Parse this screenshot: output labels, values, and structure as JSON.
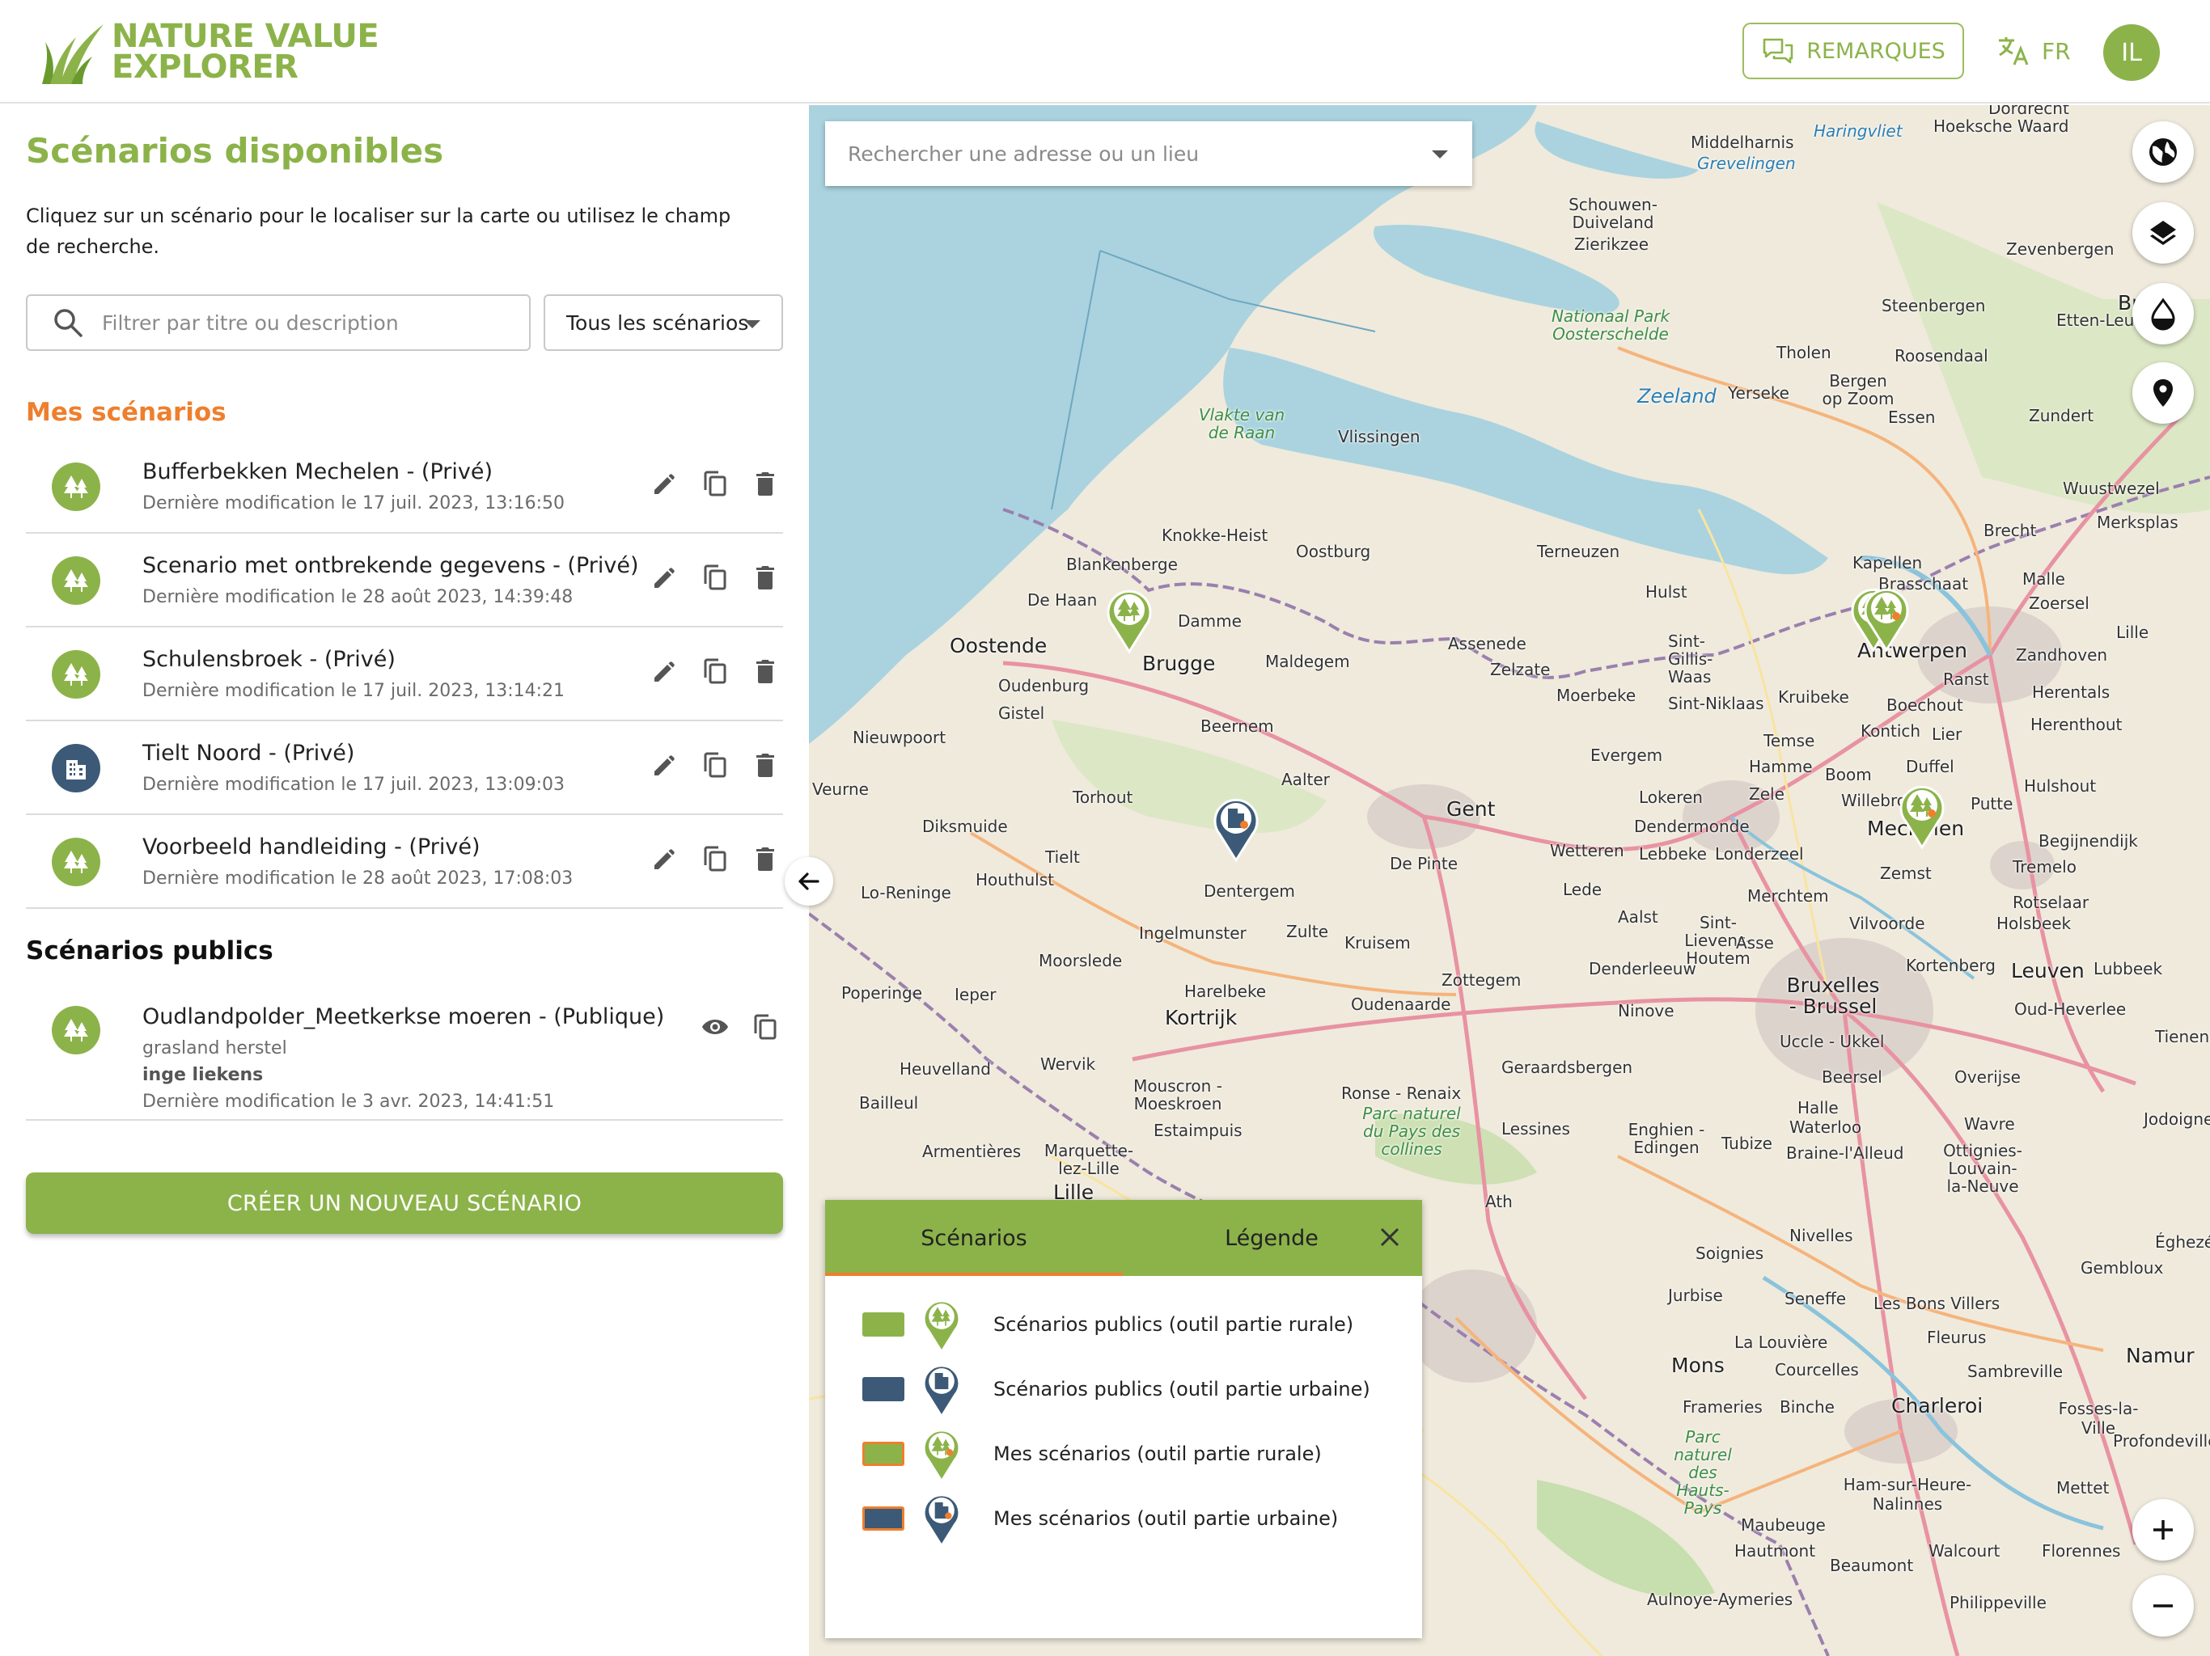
{
  "header": {
    "logo_line1": "NATURE VALUE",
    "logo_line2": "EXPLORER",
    "remarks_button": "REMARQUES",
    "language": "FR",
    "avatar_initials": "IL"
  },
  "sidebar": {
    "title": "Scénarios disponibles",
    "description": "Cliquez sur un scénario pour le localiser sur la carte ou utilisez le champ de recherche.",
    "filter_placeholder": "Filtrer par titre ou description",
    "scenario_filter_selected": "Tous les scénarios",
    "my_scenarios_heading": "Mes scénarios",
    "my_scenarios": [
      {
        "title": "Bufferbekken Mechelen - (Privé)",
        "modified": "Dernière modification le 17 juil. 2023, 13:16:50",
        "type": "rural"
      },
      {
        "title": "Scenario met ontbrekende gegevens - (Privé)",
        "modified": "Dernière modification le 28 août 2023, 14:39:48",
        "type": "rural"
      },
      {
        "title": "Schulensbroek - (Privé)",
        "modified": "Dernière modification le 17 juil. 2023, 13:14:21",
        "type": "rural"
      },
      {
        "title": "Tielt Noord - (Privé)",
        "modified": "Dernière modification le 17 juil. 2023, 13:09:03",
        "type": "urban"
      },
      {
        "title": "Voorbeeld handleiding - (Privé)",
        "modified": "Dernière modification le 28 août 2023, 17:08:03",
        "type": "rural"
      }
    ],
    "public_scenarios_heading": "Scénarios publics",
    "public_scenarios": [
      {
        "title": "Oudlandpolder_Meetkerkse moeren - (Publique)",
        "description": "grasland herstel",
        "author": "inge liekens",
        "modified": "Dernière modification le 3 avr. 2023, 14:41:51",
        "type": "rural"
      }
    ],
    "create_button": "CRÉER UN NOUVEAU SCÉNARIO"
  },
  "map": {
    "search_placeholder": "Rechercher une adresse ou un lieu",
    "places": [
      {
        "label": "Dordrecht",
        "style": "normal"
      },
      {
        "label": "Middelharnis",
        "style": "normal"
      },
      {
        "label": "Haringvliet",
        "style": "water"
      },
      {
        "label": "Hoeksche Waard",
        "style": "normal"
      },
      {
        "label": "Grevelingen",
        "style": "water"
      },
      {
        "label": "Schouwen-Duiveland",
        "style": "normal"
      },
      {
        "label": "Zierikzee",
        "style": "normal"
      },
      {
        "label": "Nationaal Park Oosterschelde",
        "style": "park"
      },
      {
        "label": "Zevenbergen",
        "style": "normal"
      },
      {
        "label": "Breda",
        "style": "big"
      },
      {
        "label": "Steenbergen",
        "style": "normal"
      },
      {
        "label": "Etten-Leur",
        "style": "normal"
      },
      {
        "label": "Tholen",
        "style": "normal"
      },
      {
        "label": "Roosendaal",
        "style": "normal"
      },
      {
        "label": "Bergen op Zoom",
        "style": "normal"
      },
      {
        "label": "Zeeland",
        "style": "water"
      },
      {
        "label": "Yerseke",
        "style": "normal"
      },
      {
        "label": "Vlakte van de Raan",
        "style": "park"
      },
      {
        "label": "Vlissingen",
        "style": "normal"
      },
      {
        "label": "Essen",
        "style": "normal"
      },
      {
        "label": "Zundert",
        "style": "normal"
      },
      {
        "label": "Wuustwezel",
        "style": "normal"
      },
      {
        "label": "Knokke-Heist",
        "style": "normal"
      },
      {
        "label": "Oostburg",
        "style": "normal"
      },
      {
        "label": "Terneuzen",
        "style": "normal"
      },
      {
        "label": "Blankenberge",
        "style": "normal"
      },
      {
        "label": "Kapellen",
        "style": "normal"
      },
      {
        "label": "Brecht",
        "style": "normal"
      },
      {
        "label": "Merksplas",
        "style": "normal"
      },
      {
        "label": "Brasschaat",
        "style": "normal"
      },
      {
        "label": "Malle",
        "style": "normal"
      },
      {
        "label": "De Haan",
        "style": "normal"
      },
      {
        "label": "Damme",
        "style": "normal"
      },
      {
        "label": "Hulst",
        "style": "normal"
      },
      {
        "label": "Zoersel",
        "style": "normal"
      },
      {
        "label": "Oostende",
        "style": "big"
      },
      {
        "label": "Brugge",
        "style": "big"
      },
      {
        "label": "Maldegem",
        "style": "normal"
      },
      {
        "label": "Assenede",
        "style": "normal"
      },
      {
        "label": "Sint-Gillis-Waas",
        "style": "normal"
      },
      {
        "label": "Antwerpen",
        "style": "big"
      },
      {
        "label": "Zandhoven",
        "style": "normal"
      },
      {
        "label": "Lille",
        "style": "normal"
      },
      {
        "label": "Oudenburg",
        "style": "normal"
      },
      {
        "label": "Zelzate",
        "style": "normal"
      },
      {
        "label": "Ranst",
        "style": "normal"
      },
      {
        "label": "Gistel",
        "style": "normal"
      },
      {
        "label": "Moerbeke",
        "style": "normal"
      },
      {
        "label": "Sint-Niklaas",
        "style": "normal"
      },
      {
        "label": "Kruibeke",
        "style": "normal"
      },
      {
        "label": "Boechout",
        "style": "normal"
      },
      {
        "label": "Herentals",
        "style": "normal"
      },
      {
        "label": "Beernem",
        "style": "normal"
      },
      {
        "label": "Kontich",
        "style": "normal"
      },
      {
        "label": "Lier",
        "style": "normal"
      },
      {
        "label": "Herenthout",
        "style": "normal"
      },
      {
        "label": "Nieuwpoort",
        "style": "normal"
      },
      {
        "label": "Temse",
        "style": "normal"
      },
      {
        "label": "Evergem",
        "style": "normal"
      },
      {
        "label": "Hamme",
        "style": "normal"
      },
      {
        "label": "Duffel",
        "style": "normal"
      },
      {
        "label": "Aalter",
        "style": "normal"
      },
      {
        "label": "Boom",
        "style": "normal"
      },
      {
        "label": "Hulshout",
        "style": "normal"
      },
      {
        "label": "Veurne",
        "style": "normal"
      },
      {
        "label": "Torhout",
        "style": "normal"
      },
      {
        "label": "Lokeren",
        "style": "normal"
      },
      {
        "label": "Zele",
        "style": "normal"
      },
      {
        "label": "Willebroek",
        "style": "normal"
      },
      {
        "label": "Putte",
        "style": "normal"
      },
      {
        "label": "Gent",
        "style": "big"
      },
      {
        "label": "Diksmuide",
        "style": "normal"
      },
      {
        "label": "Dendermonde",
        "style": "normal"
      },
      {
        "label": "Mechelen",
        "style": "big"
      },
      {
        "label": "Begijnendijk",
        "style": "normal"
      },
      {
        "label": "Wetteren",
        "style": "normal"
      },
      {
        "label": "Lebbeke",
        "style": "normal"
      },
      {
        "label": "Londerzeel",
        "style": "normal"
      },
      {
        "label": "Tielt",
        "style": "normal"
      },
      {
        "label": "De Pinte",
        "style": "normal"
      },
      {
        "label": "Tremelo",
        "style": "normal"
      },
      {
        "label": "Houthulst",
        "style": "normal"
      },
      {
        "label": "Dentergem",
        "style": "normal"
      },
      {
        "label": "Zemst",
        "style": "normal"
      },
      {
        "label": "Lo-Reninge",
        "style": "normal"
      },
      {
        "label": "Lede",
        "style": "normal"
      },
      {
        "label": "Merchtem",
        "style": "normal"
      },
      {
        "label": "Rotselaar",
        "style": "normal"
      },
      {
        "label": "Aalst",
        "style": "normal"
      },
      {
        "label": "Sint-Lievens-Houtem",
        "style": "normal"
      },
      {
        "label": "Vilvoorde",
        "style": "normal"
      },
      {
        "label": "Holsbeek",
        "style": "normal"
      },
      {
        "label": "Ingelmunster",
        "style": "normal"
      },
      {
        "label": "Zulte",
        "style": "normal"
      },
      {
        "label": "Kruisem",
        "style": "normal"
      },
      {
        "label": "Asse",
        "style": "normal"
      },
      {
        "label": "Moorslede",
        "style": "normal"
      },
      {
        "label": "Denderleeuw",
        "style": "normal"
      },
      {
        "label": "Kortenberg",
        "style": "normal"
      },
      {
        "label": "Leuven",
        "style": "big"
      },
      {
        "label": "Lubbeek",
        "style": "normal"
      },
      {
        "label": "Zottegem",
        "style": "normal"
      },
      {
        "label": "Poperinge",
        "style": "normal"
      },
      {
        "label": "Ieper",
        "style": "normal"
      },
      {
        "label": "Harelbeke",
        "style": "normal"
      },
      {
        "label": "Bruxelles - Brussel",
        "style": "big"
      },
      {
        "label": "Kortrijk",
        "style": "big"
      },
      {
        "label": "Oudenaarde",
        "style": "normal"
      },
      {
        "label": "Ninove",
        "style": "normal"
      },
      {
        "label": "Oud-Heverlee",
        "style": "normal"
      },
      {
        "label": "Uccle - Ukkel",
        "style": "normal"
      },
      {
        "label": "Tienen",
        "style": "normal"
      },
      {
        "label": "Heuvelland",
        "style": "normal"
      },
      {
        "label": "Wervik",
        "style": "normal"
      },
      {
        "label": "Geraardsbergen",
        "style": "normal"
      },
      {
        "label": "Beersel",
        "style": "normal"
      },
      {
        "label": "Overijse",
        "style": "normal"
      },
      {
        "label": "Mouscron - Moeskroen",
        "style": "normal"
      },
      {
        "label": "Ronse - Renaix",
        "style": "normal"
      },
      {
        "label": "Halle",
        "style": "normal"
      },
      {
        "label": "Bailleul",
        "style": "normal"
      },
      {
        "label": "Estaimpuis",
        "style": "normal"
      },
      {
        "label": "Parc naturel du Pays des collines",
        "style": "park"
      },
      {
        "label": "Lessines",
        "style": "normal"
      },
      {
        "label": "Enghien - Edingen",
        "style": "normal"
      },
      {
        "label": "Waterloo",
        "style": "normal"
      },
      {
        "label": "Wavre",
        "style": "normal"
      },
      {
        "label": "Jodoigne",
        "style": "normal"
      },
      {
        "label": "Armentières",
        "style": "normal"
      },
      {
        "label": "Marquette-lez-Lille",
        "style": "normal"
      },
      {
        "label": "Tubize",
        "style": "normal"
      },
      {
        "label": "Braine-l'Alleud",
        "style": "normal"
      },
      {
        "label": "Ottignies-Louvain-la-Neuve",
        "style": "normal"
      },
      {
        "label": "Lille",
        "style": "big"
      },
      {
        "label": "Ath",
        "style": "normal"
      },
      {
        "label": "Nivelles",
        "style": "normal"
      },
      {
        "label": "Éghezée",
        "style": "normal"
      },
      {
        "label": "Soignies",
        "style": "normal"
      },
      {
        "label": "Gembloux",
        "style": "normal"
      },
      {
        "label": "Jurbise",
        "style": "normal"
      },
      {
        "label": "Seneffe",
        "style": "normal"
      },
      {
        "label": "Les Bons Villers",
        "style": "normal"
      },
      {
        "label": "La Louvière",
        "style": "normal"
      },
      {
        "label": "Fleurus",
        "style": "normal"
      },
      {
        "label": "Mons",
        "style": "big"
      },
      {
        "label": "Courcelles",
        "style": "normal"
      },
      {
        "label": "Sambreville",
        "style": "normal"
      },
      {
        "label": "Namur",
        "style": "big"
      },
      {
        "label": "Frameries",
        "style": "normal"
      },
      {
        "label": "Binche",
        "style": "normal"
      },
      {
        "label": "Charleroi",
        "style": "big"
      },
      {
        "label": "Fosses-la-Ville",
        "style": "normal"
      },
      {
        "label": "Parc naturel des Hauts-Pays",
        "style": "park"
      },
      {
        "label": "Profondeville",
        "style": "normal"
      },
      {
        "label": "Ham-sur-Heure-Nalinnes",
        "style": "normal"
      },
      {
        "label": "Mettet",
        "style": "normal"
      },
      {
        "label": "Maubeuge",
        "style": "normal"
      },
      {
        "label": "Hautmont",
        "style": "normal"
      },
      {
        "label": "Walcourt",
        "style": "normal"
      },
      {
        "label": "Florennes",
        "style": "normal"
      },
      {
        "label": "Beaumont",
        "style": "normal"
      },
      {
        "label": "Aulnoye-Aymeries",
        "style": "normal"
      },
      {
        "label": "Philippeville",
        "style": "normal"
      }
    ],
    "legend": {
      "tab_scenarios": "Scénarios",
      "tab_legend": "Légende",
      "items": [
        {
          "label": "Scénarios publics (outil partie rurale)",
          "swatch_fill": "#8cb34a",
          "swatch_border": "#8cb34a",
          "marker": "rural"
        },
        {
          "label": "Scénarios publics (outil partie urbaine)",
          "swatch_fill": "#3c5a78",
          "swatch_border": "#3c5a78",
          "marker": "urban"
        },
        {
          "label": "Mes scénarios (outil partie rurale)",
          "swatch_fill": "#8cb34a",
          "swatch_border": "#ee7f2d",
          "marker": "rural-mine"
        },
        {
          "label": "Mes scénarios (outil partie urbaine)",
          "swatch_fill": "#3c5a78",
          "swatch_border": "#ee7f2d",
          "marker": "urban-mine"
        }
      ]
    }
  },
  "colors": {
    "brand_green": "#8cb34a",
    "accent_orange": "#ee7f2d",
    "urban_blue": "#3c5a78"
  },
  "icons": [
    "grass-logo-icon",
    "chat-icon",
    "translate-icon",
    "search-icon",
    "forest-icon",
    "building-icon",
    "edit-icon",
    "copy-icon",
    "delete-icon",
    "eye-icon",
    "arrow-left-icon",
    "globe-icon",
    "layers-icon",
    "drop-icon",
    "location-pin-icon",
    "plus-icon",
    "minus-icon",
    "close-icon"
  ]
}
